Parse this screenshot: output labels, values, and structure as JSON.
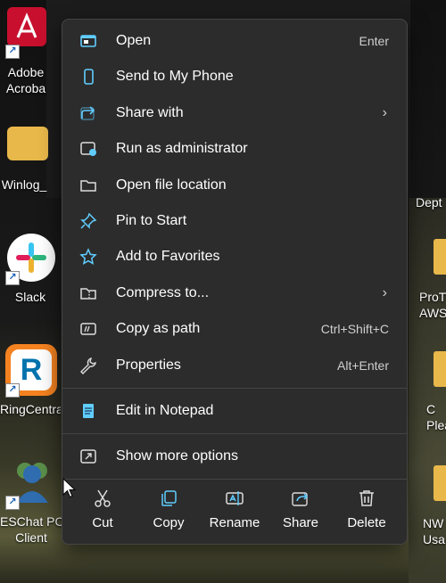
{
  "desktop": {
    "icons": [
      {
        "name": "adobe",
        "label_lines": [
          "Adobe",
          "Acroba"
        ]
      },
      {
        "name": "folder",
        "label_lines": [
          "Winlog_"
        ]
      },
      {
        "name": "slack",
        "label_lines": [
          "Slack"
        ]
      },
      {
        "name": "ringcentral",
        "label_lines": [
          "RingCentra"
        ]
      },
      {
        "name": "eschat",
        "label_lines": [
          "ESChat PC",
          "Client"
        ]
      }
    ],
    "right_labels": [
      {
        "lines": [
          "Dept"
        ]
      },
      {
        "lines": [
          "ProT",
          "AWS"
        ]
      },
      {
        "lines": [
          "C",
          "Plea"
        ]
      },
      {
        "lines": [
          "NW",
          "Usa"
        ]
      }
    ]
  },
  "menu": {
    "items": [
      {
        "label": "Open",
        "shortcut": "Enter",
        "icon": "open-window-icon"
      },
      {
        "label": "Send to My Phone",
        "shortcut": "",
        "icon": "phone-icon"
      },
      {
        "label": "Share with",
        "shortcut": "",
        "submenu": true,
        "icon": "share-icon"
      },
      {
        "label": "Run as administrator",
        "shortcut": "",
        "icon": "admin-icon"
      },
      {
        "label": "Open file location",
        "shortcut": "",
        "icon": "folder-icon"
      },
      {
        "label": "Pin to Start",
        "shortcut": "",
        "icon": "pin-icon"
      },
      {
        "label": "Add to Favorites",
        "shortcut": "",
        "icon": "star-icon"
      },
      {
        "label": "Compress to...",
        "shortcut": "",
        "submenu": true,
        "icon": "zip-icon"
      },
      {
        "label": "Copy as path",
        "shortcut": "Ctrl+Shift+C",
        "icon": "copy-path-icon"
      },
      {
        "label": "Properties",
        "shortcut": "Alt+Enter",
        "icon": "wrench-icon"
      },
      {
        "label": "Edit in Notepad",
        "shortcut": "",
        "icon": "notepad-icon"
      },
      {
        "label": "Show more options",
        "shortcut": "",
        "icon": "more-options-icon"
      }
    ],
    "actions": [
      {
        "label": "Cut",
        "icon": "scissors-icon"
      },
      {
        "label": "Copy",
        "icon": "copy-icon"
      },
      {
        "label": "Rename",
        "icon": "rename-icon"
      },
      {
        "label": "Share",
        "icon": "share-icon"
      },
      {
        "label": "Delete",
        "icon": "trash-icon"
      }
    ],
    "colors": {
      "background": "#2c2c2c",
      "accent": "#60cdff",
      "text": "#ffffff"
    }
  }
}
